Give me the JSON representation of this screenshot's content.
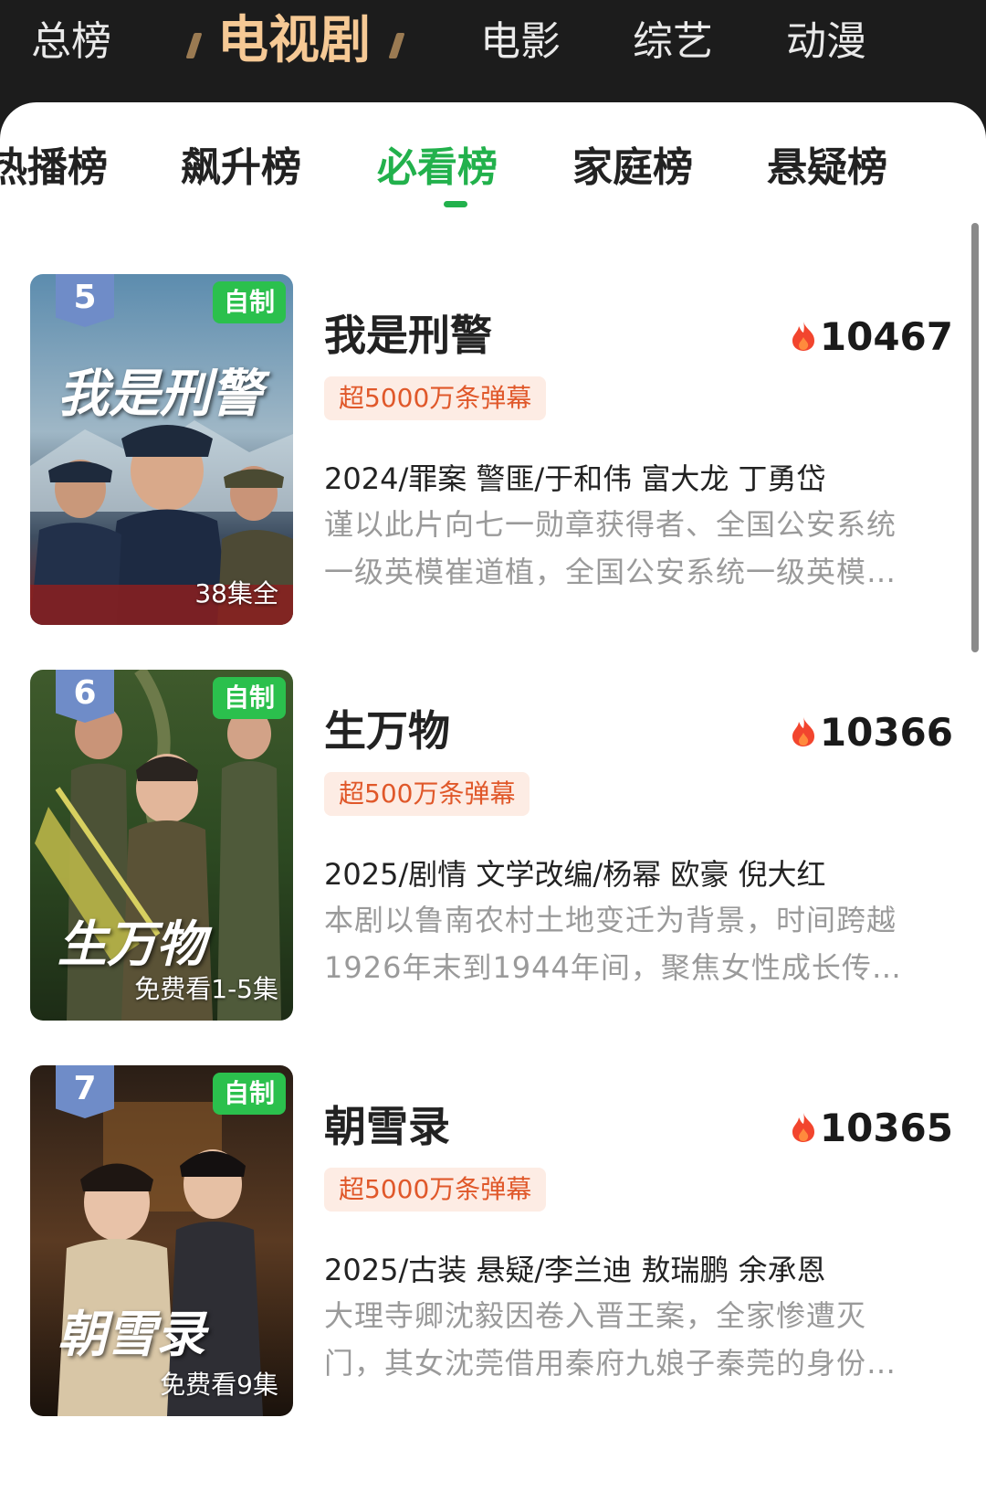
{
  "top_categories": [
    {
      "label": "总榜"
    },
    {
      "label": "电视剧"
    },
    {
      "label": "电影"
    },
    {
      "label": "综艺"
    },
    {
      "label": "动漫"
    }
  ],
  "sub_tabs": [
    {
      "label": "热播榜"
    },
    {
      "label": "飙升榜"
    },
    {
      "label": "必看榜"
    },
    {
      "label": "家庭榜"
    },
    {
      "label": "悬疑榜"
    }
  ],
  "accent_color": "#22b14c",
  "items": [
    {
      "rank": "5",
      "self_made": "自制",
      "poster_title": "我是刑警",
      "episodes": "38集全",
      "title": "我是刑警",
      "heat": "10467",
      "danmu_badge": "超5000万条弹幕",
      "meta": "2024/罪案 警匪/于和伟 富大龙 丁勇岱",
      "desc_line1": "谨以此片向七一勋章获得者、全国公安系统",
      "desc_line2": "一级英模崔道植，全国公安系统一级英模…"
    },
    {
      "rank": "6",
      "self_made": "自制",
      "poster_title": "生万物",
      "episodes": "免费看1-5集",
      "title": "生万物",
      "heat": "10366",
      "danmu_badge": "超500万条弹幕",
      "meta": "2025/剧情 文学改编/杨幂 欧豪 倪大红",
      "desc_line1": "本剧以鲁南农村土地变迁为背景，时间跨越",
      "desc_line2": "1926年末到1944年间，聚焦女性成长传…"
    },
    {
      "rank": "7",
      "self_made": "自制",
      "poster_title": "朝雪录",
      "episodes": "免费看9集",
      "title": "朝雪录",
      "heat": "10365",
      "danmu_badge": "超5000万条弹幕",
      "meta": "2025/古装 悬疑/李兰迪 敖瑞鹏 余承恩",
      "desc_line1": "大理寺卿沈毅因卷入晋王案，全家惨遭灭",
      "desc_line2": "门，其女沈莞借用秦府九娘子秦莞的身份…"
    }
  ]
}
